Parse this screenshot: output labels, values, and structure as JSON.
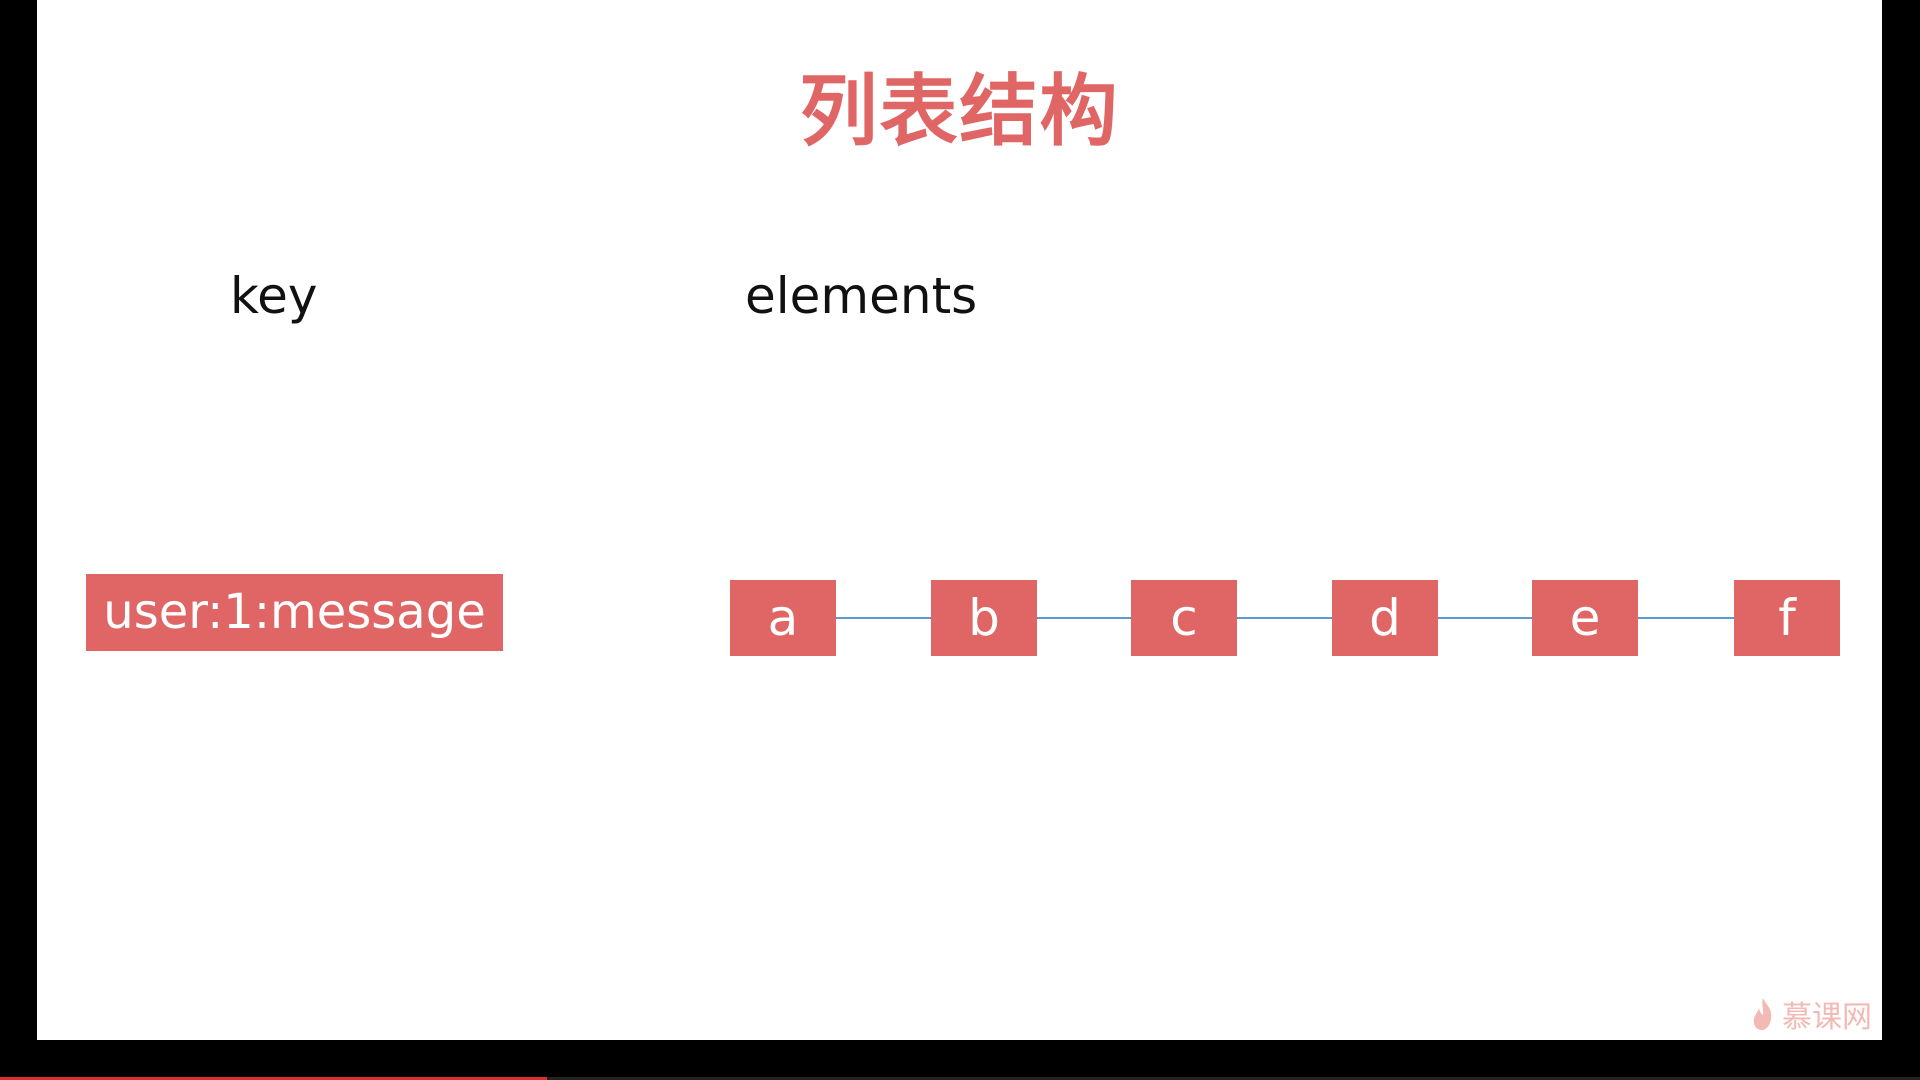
{
  "slide": {
    "title": "列表结构",
    "key_heading": "key",
    "elements_heading": "elements",
    "key_name": "user:1:message",
    "elements": [
      "a",
      "b",
      "c",
      "d",
      "e",
      "f"
    ]
  },
  "watermark": {
    "text": "慕课网",
    "icon": "flame-icon"
  },
  "video": {
    "progress_fraction": 0.285
  },
  "colors": {
    "accent": "#e06666",
    "title": "#e06666",
    "connector": "#5b9bd5",
    "background": "#ffffff"
  }
}
